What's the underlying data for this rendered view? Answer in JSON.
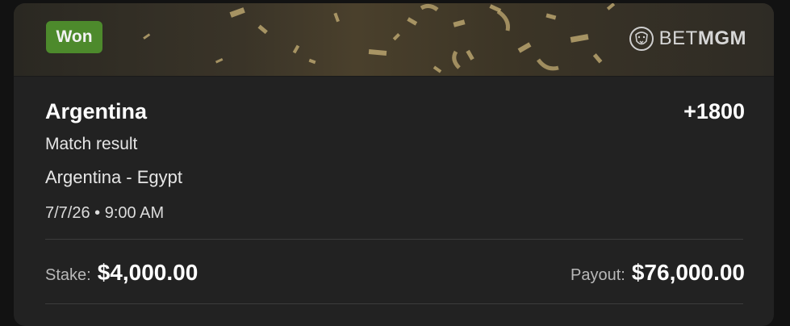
{
  "status_badge": {
    "label": "Won",
    "color": "#4d8a2c"
  },
  "brand": {
    "bet": "BET",
    "mgm": "MGM",
    "logo_icon": "lion-head-icon"
  },
  "bet": {
    "selection": "Argentina",
    "odds": "+1800",
    "market": "Match result",
    "event": "Argentina - Egypt",
    "datetime": "7/7/26 • 9:00 AM"
  },
  "stake": {
    "label": "Stake:",
    "value": "$4,000.00"
  },
  "payout": {
    "label": "Payout:",
    "value": "$76,000.00"
  },
  "colors": {
    "background": "#121212",
    "card": "#222222",
    "confetti": "#b9a46e"
  }
}
